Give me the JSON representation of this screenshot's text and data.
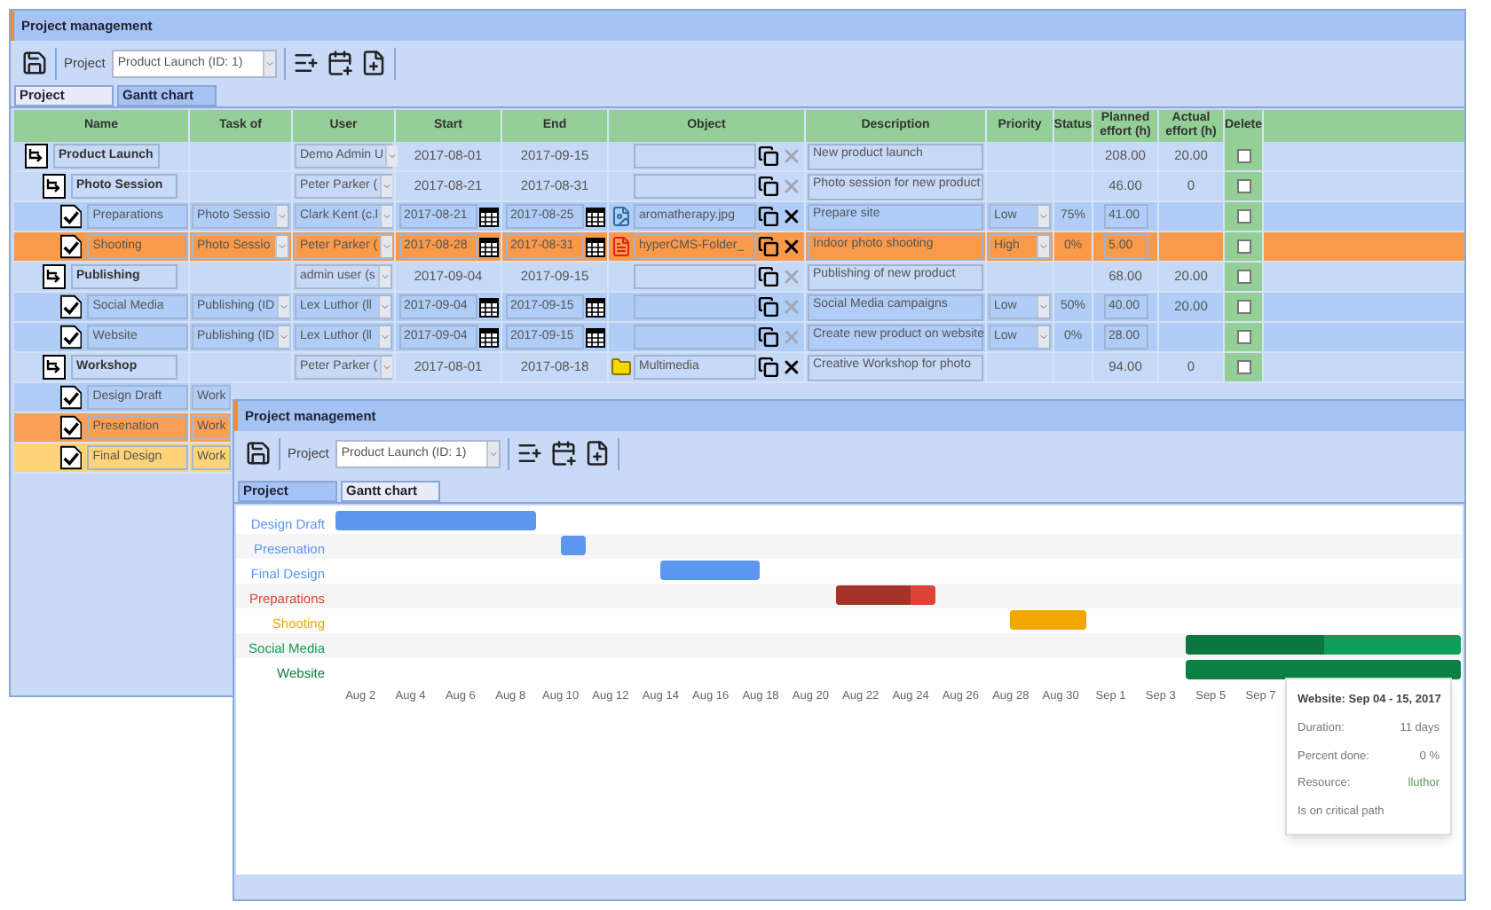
{
  "project_window": {
    "title": "Project management",
    "toolbar": {
      "project_label": "Project",
      "project_value": "Product Launch (ID: 1)"
    },
    "tabs": [
      {
        "label": "Project",
        "selected": true
      },
      {
        "label": "Gantt chart",
        "selected": false
      }
    ],
    "table": {
      "columns": [
        "Name",
        "Task of",
        "User",
        "Start",
        "End",
        "Object",
        "Description",
        "Priority",
        "Status",
        "Planned effort (h)",
        "Actual effort (h)",
        "Delete"
      ],
      "rows": [
        {
          "kind": "project",
          "name": "Product Launch",
          "user": "Demo Admin U",
          "start": "2017-08-01",
          "end": "2017-09-15",
          "removable": false,
          "description": "New product launch",
          "planned": "208.00",
          "actual": "20.00",
          "delete": false,
          "children": [
            {
              "kind": "project",
              "name": "Photo Session",
              "user": "Peter Parker (",
              "start": "2017-08-21",
              "end": "2017-08-31",
              "removable": false,
              "description": "Photo session for new product",
              "planned": "46.00",
              "actual": "0",
              "delete": false,
              "children": [
                {
                  "kind": "task",
                  "name": "Preparations",
                  "task_of": "Photo Sessio",
                  "user": "Clark Kent (c.l",
                  "start": "2017-08-21",
                  "end": "2017-08-25",
                  "object": {
                    "kind": "image",
                    "name": "aromatherapy.jpg"
                  },
                  "removable": true,
                  "description": "Prepare site",
                  "priority": "Low",
                  "status": "75%",
                  "planned": "41.00",
                  "delete": false
                },
                {
                  "kind": "task",
                  "color": "#f99a4a",
                  "name": "Shooting",
                  "task_of": "Photo Sessio",
                  "user": "Peter Parker (",
                  "start": "2017-08-28",
                  "end": "2017-08-31",
                  "object": {
                    "kind": "pdf",
                    "name": "hyperCMS-Folder_"
                  },
                  "removable": true,
                  "description": "Indoor photo shooting",
                  "priority": "High",
                  "status": "0%",
                  "planned": "5.00",
                  "delete": false
                }
              ]
            },
            {
              "kind": "project",
              "name": "Publishing",
              "user": "admin user (s",
              "start": "2017-09-04",
              "end": "2017-09-15",
              "removable": false,
              "description": "Publishing of new product",
              "planned": "68.00",
              "actual": "20.00",
              "delete": false,
              "children": [
                {
                  "kind": "task",
                  "name": "Social Media",
                  "task_of": "Publishing (ID",
                  "user": "Lex Luthor (ll",
                  "start": "2017-09-04",
                  "end": "2017-09-15",
                  "removable": false,
                  "description": "Social Media campaigns",
                  "priority": "Low",
                  "status": "50%",
                  "planned": "40.00",
                  "actual": "20.00",
                  "delete": false
                },
                {
                  "kind": "task",
                  "name": "Website",
                  "task_of": "Publishing (ID",
                  "user": "Lex Luthor (ll",
                  "start": "2017-09-04",
                  "end": "2017-09-15",
                  "removable": false,
                  "description": "Create new product on website",
                  "priority": "Low",
                  "status": "0%",
                  "planned": "28.00",
                  "delete": false
                }
              ]
            },
            {
              "kind": "project",
              "name": "Workshop",
              "user": "Peter Parker (",
              "start": "2017-08-01",
              "end": "2017-08-18",
              "object": {
                "kind": "folder",
                "name": "Multimedia"
              },
              "removable": true,
              "description": "Creative Workshop for photo",
              "planned": "94.00",
              "actual": "0",
              "delete": false,
              "children": [
                {
                  "kind": "task",
                  "name": "Design Draft",
                  "task_of": "Work"
                },
                {
                  "kind": "task",
                  "color": "#f8a057",
                  "name": "Presenation",
                  "task_of": "Work"
                },
                {
                  "kind": "task",
                  "color": "#ffd479",
                  "name": "Final Design",
                  "task_of": "Work"
                }
              ]
            }
          ]
        }
      ]
    }
  },
  "gantt_window": {
    "title": "Project management",
    "toolbar": {
      "project_label": "Project",
      "project_value": "Product Launch (ID: 1)"
    },
    "tabs": [
      {
        "label": "Project",
        "selected": false
      },
      {
        "label": "Gantt chart",
        "selected": true
      }
    ],
    "gantt": {
      "tick_labels": [
        "Aug 2",
        "Aug 4",
        "Aug 6",
        "Aug 8",
        "Aug 10",
        "Aug 12",
        "Aug 14",
        "Aug 16",
        "Aug 18",
        "Aug 20",
        "Aug 22",
        "Aug 24",
        "Aug 26",
        "Aug 28",
        "Aug 30",
        "Sep 1",
        "Sep 3",
        "Sep 5",
        "Sep 7"
      ],
      "tasks": [
        {
          "name": "Design Draft",
          "color": "#5b96f0",
          "level": 0
        },
        {
          "name": "Presenation",
          "color": "#5b96f0",
          "level": 0
        },
        {
          "name": "Final Design",
          "color": "#5b96f0",
          "level": 0
        },
        {
          "name": "Preparations",
          "color": "#db4437",
          "level": 0.75
        },
        {
          "name": "Shooting",
          "color": "#f2a600",
          "level": 0
        },
        {
          "name": "Social Media",
          "color": "#0f9d58",
          "level": 0.5
        },
        {
          "name": "Website",
          "color": "#0b8043",
          "level": 0
        }
      ]
    },
    "tooltip": {
      "title": "Website: Sep 04 - 15, 2017",
      "lines": [
        {
          "label": "Duration:",
          "value": "11 days"
        },
        {
          "label": "Percent done:",
          "value": "0 %"
        },
        {
          "label": "Resource:",
          "value": "lluthor"
        }
      ],
      "note": "Is on critical path"
    }
  }
}
